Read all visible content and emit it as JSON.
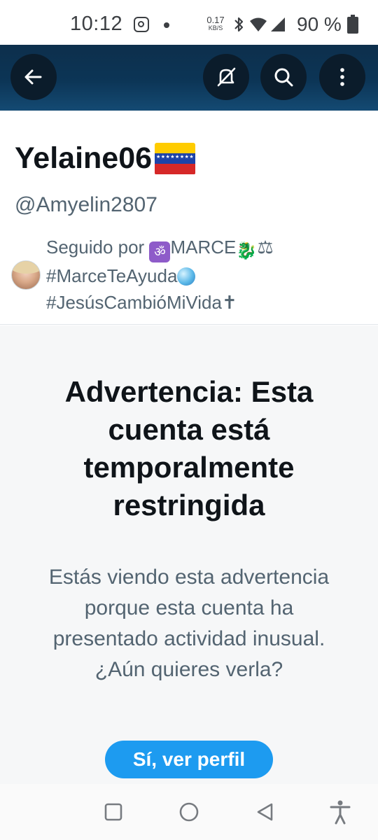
{
  "status_bar": {
    "time": "10:12",
    "net_speed_value": "0.17",
    "net_speed_unit": "KB/S",
    "battery_percent": "90 %"
  },
  "header": {
    "back_icon": "arrow-left-icon",
    "mute_icon": "mute-icon",
    "search_icon": "search-icon",
    "more_icon": "more-vertical-icon",
    "background": "#0c3556"
  },
  "profile": {
    "display_name": "Yelaine06",
    "display_name_emoji": "venezuela-flag",
    "handle": "@Amyelin2807",
    "followed_by_prefix": "Seguido por",
    "followed_by_name": "MARCE",
    "followed_by_tag1": "#MarceTeAyuda",
    "followed_by_tag2": "#JesúsCambióMiVida",
    "cross": "✝",
    "scales": "⚖"
  },
  "warning": {
    "title": "Advertencia: Esta cuenta está temporalmente restringida",
    "text": "Estás viendo esta advertencia porque esta cuenta ha presentado actividad inusual. ¿Aún quieres verla?",
    "button_label": "Sí, ver perfil",
    "accent": "#1d9bf0"
  },
  "nav_bar": {
    "recents_icon": "square-icon",
    "home_icon": "circle-icon",
    "back_icon": "triangle-back-icon",
    "accessibility_icon": "accessibility-icon"
  }
}
